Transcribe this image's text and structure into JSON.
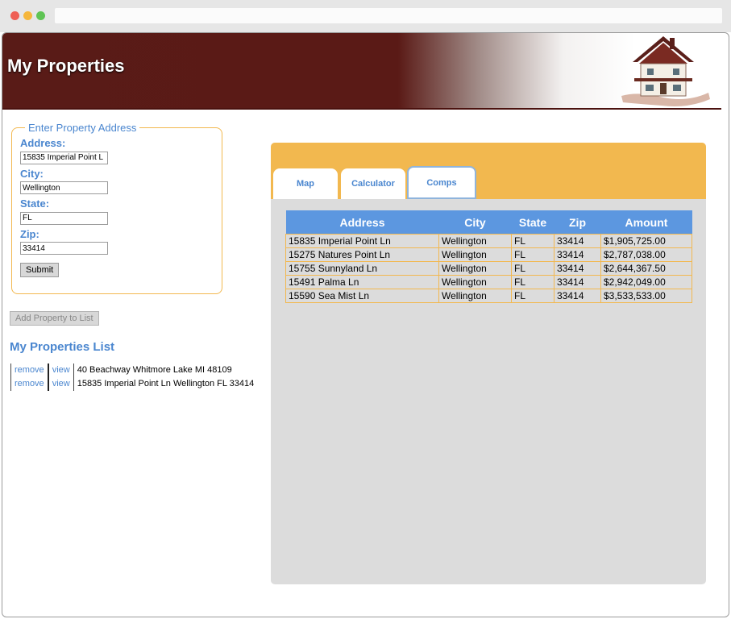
{
  "header": {
    "title": "My Properties"
  },
  "form": {
    "legend": "Enter Property Address",
    "address_label": "Address:",
    "address_value": "15835 Imperial Point L",
    "city_label": "City:",
    "city_value": "Wellington",
    "state_label": "State:",
    "state_value": "FL",
    "zip_label": "Zip:",
    "zip_value": "33414",
    "submit_label": "Submit"
  },
  "add_button": "Add Property to List",
  "list": {
    "title": "My Properties List",
    "items": [
      {
        "remove": "remove",
        "view": "view",
        "text": "40 Beachway Whitmore Lake MI 48109"
      },
      {
        "remove": "remove",
        "view": "view",
        "text": "15835 Imperial Point Ln Wellington FL 33414"
      }
    ]
  },
  "tabs": [
    {
      "label": "Map"
    },
    {
      "label": "Calculator"
    },
    {
      "label": "Comps"
    }
  ],
  "comps": {
    "headers": [
      "Address",
      "City",
      "State",
      "Zip",
      "Amount"
    ],
    "rows": [
      [
        "15835 Imperial Point Ln",
        "Wellington",
        "FL",
        "33414",
        "$1,905,725.00"
      ],
      [
        "15275 Natures Point Ln",
        "Wellington",
        "FL",
        "33414",
        "$2,787,038.00"
      ],
      [
        "15755 Sunnyland Ln",
        "Wellington",
        "FL",
        "33414",
        "$2,644,367.50"
      ],
      [
        "15491 Palma Ln",
        "Wellington",
        "FL",
        "33414",
        "$2,942,049.00"
      ],
      [
        "15590 Sea Mist Ln",
        "Wellington",
        "FL",
        "33414",
        "$3,533,533.00"
      ]
    ]
  }
}
